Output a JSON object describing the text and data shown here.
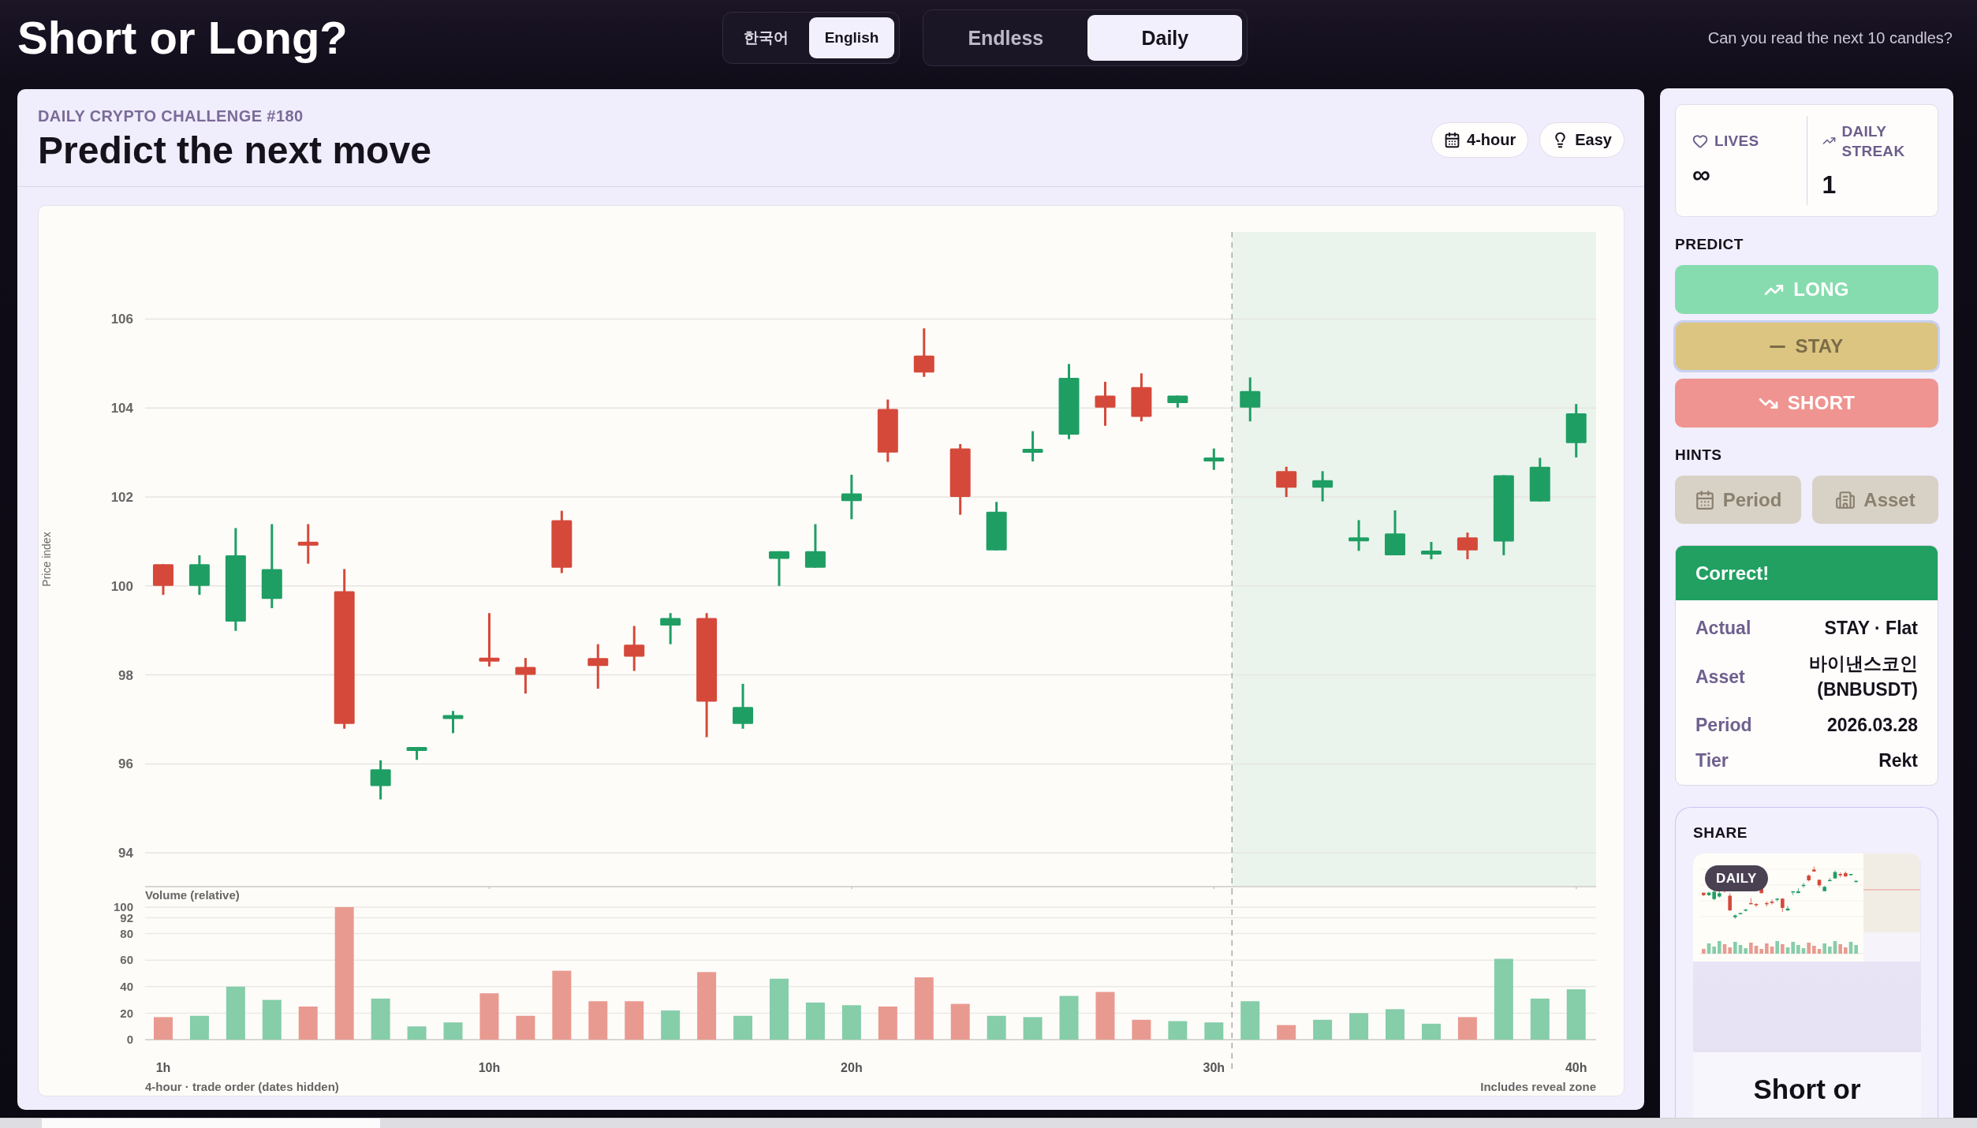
{
  "app": {
    "title": "Short or Long?",
    "tagline": "Can you read the next 10 candles?"
  },
  "language_toggle": [
    {
      "label": "한국어",
      "selected": false
    },
    {
      "label": "English",
      "selected": true
    }
  ],
  "mode_tabs": [
    {
      "label": "Endless",
      "selected": false
    },
    {
      "label": "Daily",
      "selected": true
    }
  ],
  "challenge": {
    "eyebrow": "DAILY CRYPTO CHALLENGE #180",
    "title": "Predict the next move",
    "chips": [
      {
        "label": "4-hour",
        "kind": "timeframe"
      },
      {
        "label": "Easy",
        "kind": "difficulty"
      }
    ]
  },
  "chart": {
    "chart_data": [
      {
        "type": "candlestick",
        "ylabel": "Price index",
        "x": [
          1,
          2,
          3,
          4,
          5,
          6,
          7,
          8,
          9,
          10,
          11,
          12,
          13,
          14,
          15,
          16,
          17,
          18,
          19,
          20,
          21,
          22,
          23,
          24,
          25,
          26,
          27,
          28,
          29,
          30,
          31,
          32,
          33,
          34,
          35,
          36,
          37,
          38,
          39,
          40
        ],
        "ohlc": [
          [
            100.49,
            100.49,
            99.8,
            100.0
          ],
          [
            100.0,
            100.69,
            99.8,
            100.49
          ],
          [
            99.2,
            101.3,
            98.99,
            100.69
          ],
          [
            99.71,
            101.39,
            99.5,
            100.38
          ],
          [
            100.97,
            101.39,
            100.5,
            100.93
          ],
          [
            99.88,
            100.38,
            96.79,
            96.9
          ],
          [
            95.5,
            96.08,
            95.2,
            95.88
          ],
          [
            96.3,
            96.37,
            96.09,
            96.37
          ],
          [
            97.04,
            97.19,
            96.69,
            97.07
          ],
          [
            98.38,
            99.39,
            98.19,
            98.31
          ],
          [
            98.18,
            98.38,
            97.58,
            98.0
          ],
          [
            101.48,
            101.69,
            100.29,
            100.41
          ],
          [
            98.38,
            98.69,
            97.69,
            98.2
          ],
          [
            98.68,
            99.1,
            98.09,
            98.41
          ],
          [
            99.11,
            99.39,
            98.69,
            99.28
          ],
          [
            99.28,
            99.39,
            96.6,
            97.4
          ],
          [
            96.9,
            97.8,
            96.79,
            97.28
          ],
          [
            100.61,
            100.78,
            100.0,
            100.78
          ],
          [
            100.41,
            101.39,
            100.41,
            100.78
          ],
          [
            101.91,
            102.5,
            101.5,
            102.08
          ],
          [
            103.98,
            104.19,
            102.79,
            103.0
          ],
          [
            105.18,
            105.79,
            104.7,
            104.8
          ],
          [
            103.09,
            103.19,
            101.6,
            102.0
          ],
          [
            100.8,
            101.89,
            100.8,
            101.67
          ],
          [
            103.01,
            103.48,
            102.8,
            103.07
          ],
          [
            103.4,
            104.99,
            103.3,
            104.68
          ],
          [
            104.28,
            104.59,
            103.6,
            104.01
          ],
          [
            104.47,
            104.78,
            103.7,
            103.8
          ],
          [
            104.11,
            104.28,
            104.01,
            104.28
          ],
          [
            102.81,
            103.09,
            102.61,
            102.88
          ],
          [
            104.01,
            104.69,
            103.7,
            104.38
          ],
          [
            102.58,
            102.68,
            102.0,
            102.21
          ],
          [
            102.21,
            102.58,
            101.9,
            102.38
          ],
          [
            101.02,
            101.48,
            100.79,
            101.08
          ],
          [
            100.69,
            101.7,
            100.69,
            101.18
          ],
          [
            100.72,
            100.99,
            100.6,
            100.78
          ],
          [
            101.09,
            101.2,
            100.6,
            100.8
          ],
          [
            101.0,
            102.49,
            100.69,
            102.49
          ],
          [
            101.9,
            102.88,
            101.9,
            102.68
          ],
          [
            103.21,
            104.09,
            102.89,
            103.88
          ]
        ],
        "xlim": [
          0.5,
          40.55
        ],
        "ylim": [
          93.24,
          107.96
        ],
        "yticks": [
          94,
          96,
          98,
          100,
          102,
          104,
          106
        ],
        "xticks": [
          10,
          20,
          30,
          40
        ],
        "tick_labels": "y",
        "grid": "y",
        "ref_lines": [
          {
            "axis": "x",
            "value": 30.5,
            "color": "#a9a9a9",
            "line_style": "dashed"
          }
        ],
        "bands": [
          {
            "axis": "x",
            "from": 30.5,
            "to": 40.55,
            "color": "#eaf4ec"
          }
        ]
      },
      {
        "type": "bar",
        "title": "Volume (relative)",
        "xlabel": "4-hour · trade order (dates hidden)",
        "x": [
          1,
          2,
          3,
          4,
          5,
          6,
          7,
          8,
          9,
          10,
          11,
          12,
          13,
          14,
          15,
          16,
          17,
          18,
          19,
          20,
          21,
          22,
          23,
          24,
          25,
          26,
          27,
          28,
          29,
          30,
          31,
          32,
          33,
          34,
          35,
          36,
          37,
          38,
          39,
          40
        ],
        "values": [
          17,
          18,
          40,
          30,
          25,
          100,
          31,
          10,
          13,
          35,
          18,
          52,
          29,
          29,
          22,
          51,
          18,
          46,
          28,
          26,
          25,
          47,
          27,
          18,
          17,
          33,
          36,
          15,
          14,
          13,
          29,
          11,
          15,
          20,
          23,
          12,
          17,
          61,
          31,
          38
        ],
        "colors": [
          "#e99a90",
          "#86cda9",
          "#86cda9",
          "#86cda9",
          "#e99a90",
          "#e99a90",
          "#86cda9",
          "#86cda9",
          "#86cda9",
          "#e99a90",
          "#e99a90",
          "#e99a90",
          "#e99a90",
          "#e99a90",
          "#86cda9",
          "#e99a90",
          "#86cda9",
          "#86cda9",
          "#86cda9",
          "#86cda9",
          "#e99a90",
          "#e99a90",
          "#e99a90",
          "#86cda9",
          "#86cda9",
          "#86cda9",
          "#e99a90",
          "#e99a90",
          "#86cda9",
          "#86cda9",
          "#86cda9",
          "#e99a90",
          "#86cda9",
          "#86cda9",
          "#86cda9",
          "#86cda9",
          "#e99a90",
          "#86cda9",
          "#86cda9",
          "#86cda9"
        ],
        "xlim": [
          0.5,
          40.55
        ],
        "ylim": [
          0,
          100
        ],
        "xticks": [
          {
            "value": 1,
            "label": "1h"
          },
          {
            "value": 10,
            "label": "10h"
          },
          {
            "value": 20,
            "label": "20h"
          },
          {
            "value": 30,
            "label": "30h"
          },
          {
            "value": 40,
            "label": "40h"
          }
        ],
        "yticks": [
          0,
          20,
          40,
          60,
          80,
          92,
          100
        ],
        "grid": "y",
        "ref_lines": [
          {
            "axis": "x",
            "value": 30.5,
            "color": "#a9a9a9",
            "line_style": "dashed"
          }
        ],
        "annotations": [
          "Includes reveal zone"
        ]
      }
    ]
  },
  "sidebar": {
    "stats": [
      {
        "label": "LIVES",
        "kind": "lives",
        "value": "∞"
      },
      {
        "label": "DAILY STREAK",
        "kind": "streak",
        "value": "1"
      }
    ],
    "predict_label": "PREDICT",
    "predictions": [
      {
        "label": "LONG",
        "kind": "long",
        "selected": false
      },
      {
        "label": "STAY",
        "kind": "stay",
        "selected": true
      },
      {
        "label": "SHORT",
        "kind": "short",
        "selected": false
      }
    ],
    "hints_label": "HINTS",
    "hints": [
      {
        "label": "Period",
        "kind": "period",
        "disabled": true
      },
      {
        "label": "Asset",
        "kind": "asset",
        "disabled": true
      }
    ],
    "result": {
      "kind": "correct",
      "title": "Correct!",
      "rows": [
        {
          "label": "Actual",
          "value": "STAY · Flat"
        },
        {
          "label": "Asset",
          "value": "바이낸스코인 (BNBUSDT)"
        },
        {
          "label": "Period",
          "value": "2026.03.28"
        },
        {
          "label": "Tier",
          "value": "Rekt"
        }
      ]
    },
    "share": {
      "label": "SHARE",
      "badge": "DAILY",
      "title": "Short or"
    }
  }
}
